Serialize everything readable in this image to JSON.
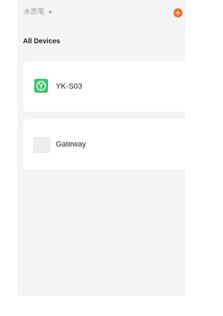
{
  "header": {
    "home_name": "水质笔",
    "add_icon": "plus-circle-icon",
    "add_color": "#f26b2a"
  },
  "section": {
    "title": "All Devices",
    "more_label": "···"
  },
  "devices": [
    {
      "name": "YK-S03",
      "icon": "y-sensor-icon",
      "icon_color": "#3fc56f"
    },
    {
      "name": "Gateway",
      "icon": "gateway-icon",
      "icon_color": "#eeeeee"
    }
  ],
  "colors": {
    "background": "#f4f4f6",
    "card": "#ffffff"
  }
}
